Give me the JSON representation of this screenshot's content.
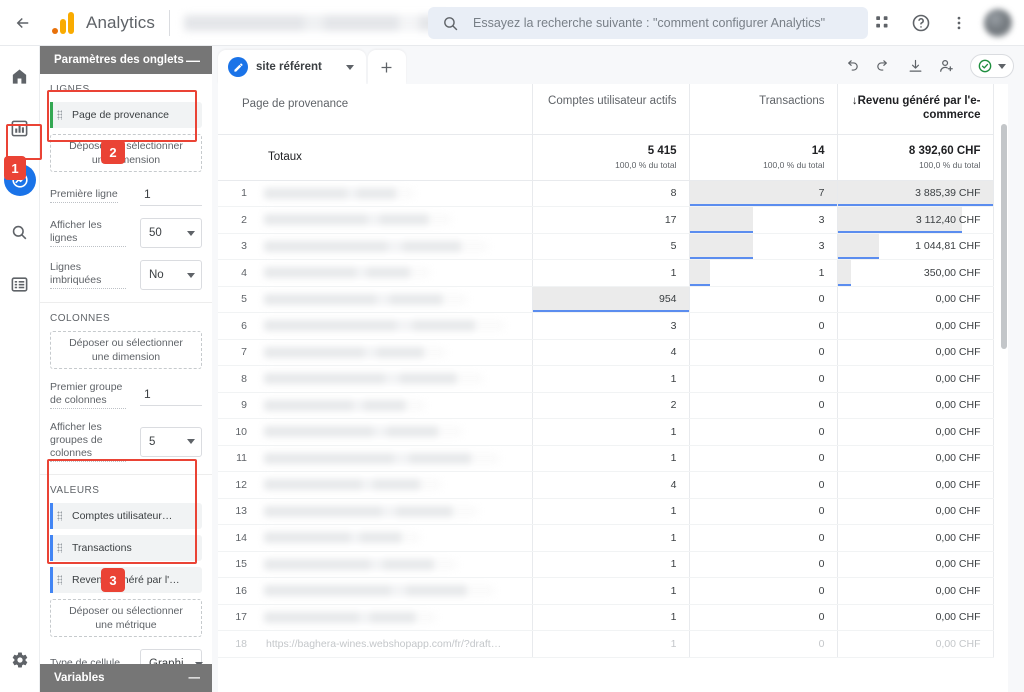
{
  "topbar": {
    "back_icon": "arrow-left-icon",
    "brand": "Analytics",
    "account_masked": "",
    "search": {
      "icon": "search-icon",
      "value": "",
      "placeholder": "Essayez la recherche suivante : \"comment configurer Analytics\""
    },
    "apps_icon": "apps-grid-icon",
    "help_icon": "help-circle-icon",
    "more_icon": "more-vertical-icon",
    "avatar": "user-avatar"
  },
  "rail": {
    "items": [
      {
        "name": "home",
        "icon": "home-icon",
        "active": false
      },
      {
        "name": "reports",
        "icon": "bar-chart-icon",
        "active": false
      },
      {
        "name": "explore",
        "icon": "explore-icon",
        "active": true
      },
      {
        "name": "advertising",
        "icon": "search-badge-icon",
        "active": false
      },
      {
        "name": "configure",
        "icon": "list-table-icon",
        "active": false
      }
    ],
    "gear_icon": "gear-icon"
  },
  "panel": {
    "title": "Paramètres des onglets",
    "minimize_label": "—",
    "rows": {
      "section_title": "LIGNES",
      "chips": [
        {
          "label": "Page de provenance",
          "kind": "dimension"
        }
      ],
      "dropzone": "Déposer ou sélectionner une dimension",
      "first_row_label": "Première ligne",
      "first_row_value": "1",
      "show_rows_label": "Afficher les lignes",
      "show_rows_value": "50",
      "nested_rows_label": "Lignes imbriquées",
      "nested_rows_value": "No"
    },
    "columns": {
      "section_title": "COLONNES",
      "dropzone": "Déposer ou sélectionner une dimension",
      "first_group_label": "Premier groupe de colonnes",
      "first_group_value": "1",
      "show_groups_label": "Afficher les groupes de colonnes",
      "show_groups_value": "5"
    },
    "values": {
      "section_title": "VALEURS",
      "chips": [
        {
          "label": "Comptes utilisateur…",
          "kind": "metric"
        },
        {
          "label": "Transactions",
          "kind": "metric"
        },
        {
          "label": "Revenu généré par l'…",
          "kind": "metric"
        }
      ],
      "dropzone": "Déposer ou sélectionner une métrique",
      "cell_type_label": "Type de cellule",
      "cell_type_value": "Graphi…"
    },
    "footer_title": "Variables",
    "footer_minimize": "—"
  },
  "annotations": [
    {
      "badge": "1",
      "target": "rail-item-explore"
    },
    {
      "badge": "2",
      "target": "rows-section"
    },
    {
      "badge": "3",
      "target": "values-section"
    }
  ],
  "report": {
    "tab": {
      "label": "site référent",
      "avatar_icon": "pencil-icon",
      "caret_icon": "chevron-down-icon"
    },
    "add_tab_icon": "plus-icon",
    "tools": [
      {
        "name": "undo",
        "icon": "undo-icon"
      },
      {
        "name": "redo",
        "icon": "redo-icon"
      },
      {
        "name": "download",
        "icon": "download-icon"
      },
      {
        "name": "share",
        "icon": "person-add-icon"
      }
    ],
    "share_status": {
      "icon": "check-circle-icon",
      "color": "#1e8e3e",
      "caret_icon": "chevron-down-icon"
    }
  },
  "chart_data": {
    "type": "table",
    "title": "",
    "columns": [
      {
        "key": "dimension",
        "label": "Page de provenance",
        "align": "left",
        "sorted": false
      },
      {
        "key": "users",
        "label": "Comptes utilisateur actifs",
        "align": "right",
        "sorted": false
      },
      {
        "key": "trans",
        "label": "Transactions",
        "align": "right",
        "sorted": false
      },
      {
        "key": "revenue",
        "label": "↓Revenu généré par l'e-commerce",
        "align": "right",
        "sorted": true
      }
    ],
    "totals_label": "Totaux",
    "totals": [
      {
        "value": "5 415",
        "sub": "100,0 % du total"
      },
      {
        "value": "14",
        "sub": "100,0 % du total"
      },
      {
        "value": "8 392,60 CHF",
        "sub": "100,0 % du total"
      }
    ],
    "rows": [
      {
        "n": "1",
        "dim": "",
        "masked": true,
        "users": "8",
        "users_bar": 0,
        "trans": "7",
        "trans_bar": 100,
        "revenue": "3 885,39 CHF",
        "rev_bar": 100,
        "faded": false
      },
      {
        "n": "2",
        "dim": "",
        "masked": true,
        "users": "17",
        "users_bar": 0,
        "trans": "3",
        "trans_bar": 43,
        "revenue": "3 112,40 CHF",
        "rev_bar": 80,
        "faded": false
      },
      {
        "n": "3",
        "dim": "",
        "masked": true,
        "users": "5",
        "users_bar": 0,
        "trans": "3",
        "trans_bar": 43,
        "revenue": "1 044,81 CHF",
        "rev_bar": 27,
        "faded": false
      },
      {
        "n": "4",
        "dim": "",
        "masked": true,
        "users": "1",
        "users_bar": 0,
        "trans": "1",
        "trans_bar": 14,
        "revenue": "350,00 CHF",
        "rev_bar": 9,
        "faded": false
      },
      {
        "n": "5",
        "dim": "",
        "masked": true,
        "users": "954",
        "users_bar": 100,
        "trans": "0",
        "trans_bar": 0,
        "revenue": "0,00 CHF",
        "rev_bar": 0,
        "faded": false
      },
      {
        "n": "6",
        "dim": "",
        "masked": true,
        "users": "3",
        "users_bar": 0,
        "trans": "0",
        "trans_bar": 0,
        "revenue": "0,00 CHF",
        "rev_bar": 0,
        "faded": false
      },
      {
        "n": "7",
        "dim": "",
        "masked": true,
        "users": "4",
        "users_bar": 0,
        "trans": "0",
        "trans_bar": 0,
        "revenue": "0,00 CHF",
        "rev_bar": 0,
        "faded": false
      },
      {
        "n": "8",
        "dim": "",
        "masked": true,
        "users": "1",
        "users_bar": 0,
        "trans": "0",
        "trans_bar": 0,
        "revenue": "0,00 CHF",
        "rev_bar": 0,
        "faded": false
      },
      {
        "n": "9",
        "dim": "",
        "masked": true,
        "users": "2",
        "users_bar": 0,
        "trans": "0",
        "trans_bar": 0,
        "revenue": "0,00 CHF",
        "rev_bar": 0,
        "faded": false
      },
      {
        "n": "10",
        "dim": "",
        "masked": true,
        "users": "1",
        "users_bar": 0,
        "trans": "0",
        "trans_bar": 0,
        "revenue": "0,00 CHF",
        "rev_bar": 0,
        "faded": false
      },
      {
        "n": "11",
        "dim": "",
        "masked": true,
        "users": "1",
        "users_bar": 0,
        "trans": "0",
        "trans_bar": 0,
        "revenue": "0,00 CHF",
        "rev_bar": 0,
        "faded": false
      },
      {
        "n": "12",
        "dim": "",
        "masked": true,
        "users": "4",
        "users_bar": 0,
        "trans": "0",
        "trans_bar": 0,
        "revenue": "0,00 CHF",
        "rev_bar": 0,
        "faded": false
      },
      {
        "n": "13",
        "dim": "",
        "masked": true,
        "users": "1",
        "users_bar": 0,
        "trans": "0",
        "trans_bar": 0,
        "revenue": "0,00 CHF",
        "rev_bar": 0,
        "faded": false
      },
      {
        "n": "14",
        "dim": "",
        "masked": true,
        "users": "1",
        "users_bar": 0,
        "trans": "0",
        "trans_bar": 0,
        "revenue": "0,00 CHF",
        "rev_bar": 0,
        "faded": false
      },
      {
        "n": "15",
        "dim": "",
        "masked": true,
        "users": "1",
        "users_bar": 0,
        "trans": "0",
        "trans_bar": 0,
        "revenue": "0,00 CHF",
        "rev_bar": 0,
        "faded": false
      },
      {
        "n": "16",
        "dim": "",
        "masked": true,
        "users": "1",
        "users_bar": 0,
        "trans": "0",
        "trans_bar": 0,
        "revenue": "0,00 CHF",
        "rev_bar": 0,
        "faded": false
      },
      {
        "n": "17",
        "dim": "",
        "masked": true,
        "users": "1",
        "users_bar": 0,
        "trans": "0",
        "trans_bar": 0,
        "revenue": "0,00 CHF",
        "rev_bar": 0,
        "faded": false
      },
      {
        "n": "18",
        "dim": "https://baghera-wines.webshopapp.com/fr/?draft…",
        "masked": false,
        "users": "1",
        "users_bar": 0,
        "trans": "0",
        "trans_bar": 0,
        "revenue": "0,00 CHF",
        "rev_bar": 0,
        "faded": true
      }
    ]
  },
  "colors": {
    "accent_blue": "#1a73e8",
    "bar_fill": "#ebebeb",
    "bar_underline": "#5b8def",
    "annotation_red": "#ea4335",
    "panel_header_gray": "#767676",
    "dimension_green": "#34a853",
    "metric_blue": "#4285f4",
    "status_green": "#1e8e3e"
  }
}
